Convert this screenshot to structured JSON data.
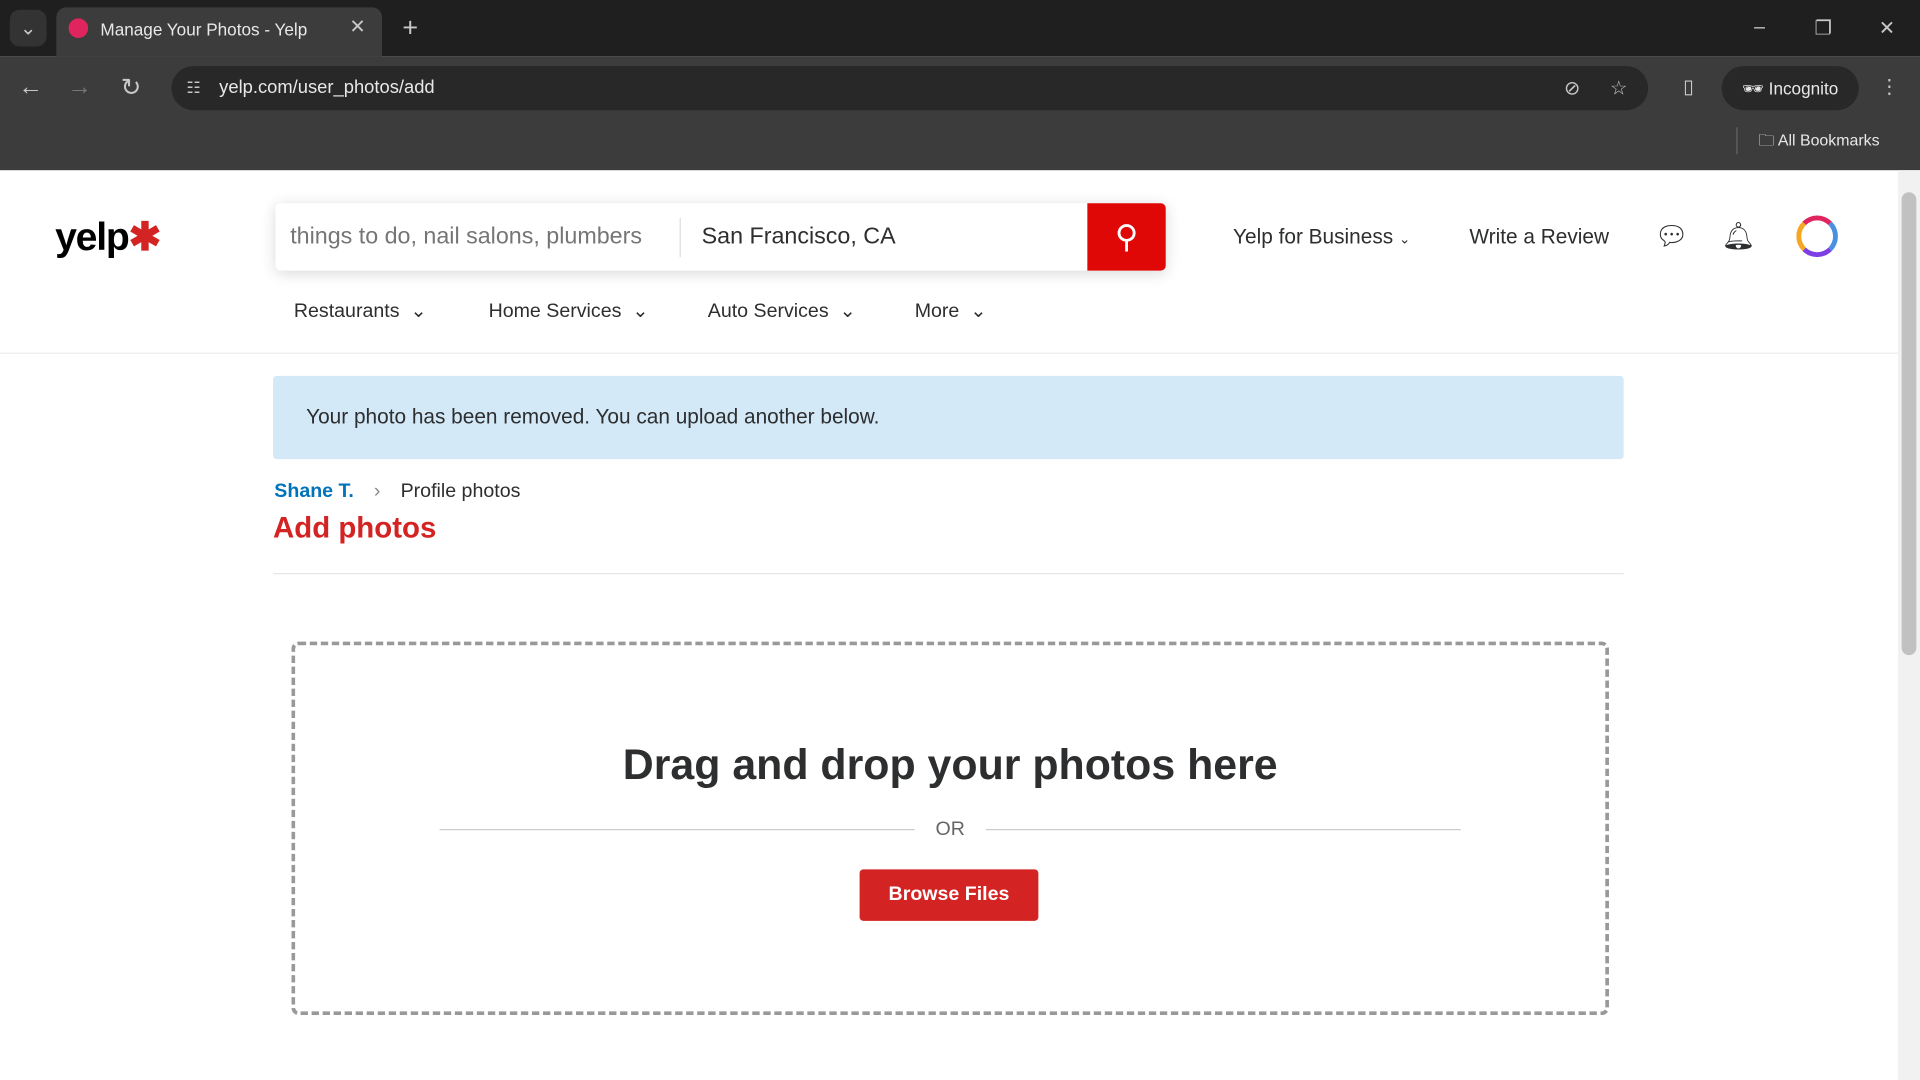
{
  "browser": {
    "tab_title": "Manage Your Photos - Yelp",
    "url": "yelp.com/user_photos/add",
    "incognito_label": "Incognito",
    "bookmarks_label": "All Bookmarks"
  },
  "header": {
    "logo": "yelp",
    "search_placeholder": "things to do, nail salons, plumbers",
    "location_value": "San Francisco, CA",
    "yelp_for_business": "Yelp for Business",
    "write_review": "Write a Review",
    "brand_color": "#d32323"
  },
  "nav": {
    "items": [
      {
        "label": "Restaurants"
      },
      {
        "label": "Home Services"
      },
      {
        "label": "Auto Services"
      },
      {
        "label": "More"
      }
    ]
  },
  "banner": {
    "message": "Your photo has been removed. You can upload another below."
  },
  "breadcrumb": {
    "user": "Shane T.",
    "current": "Profile photos"
  },
  "page_title": "Add photos",
  "dropzone": {
    "heading": "Drag and drop your photos here",
    "or": "OR",
    "browse": "Browse Files"
  }
}
